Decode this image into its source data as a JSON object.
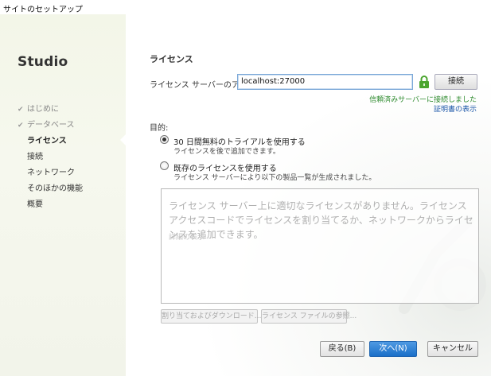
{
  "window": {
    "title": "サイトのセットアップ"
  },
  "sidebar": {
    "brand": "Studio",
    "items": [
      {
        "label": "はじめに",
        "state": "done"
      },
      {
        "label": "データベース",
        "state": "done"
      },
      {
        "label": "ライセンス",
        "state": "active"
      },
      {
        "label": "接続",
        "state": "pending"
      },
      {
        "label": "ネットワーク",
        "state": "pending"
      },
      {
        "label": "そのほかの機能",
        "state": "pending"
      },
      {
        "label": "概要",
        "state": "pending"
      }
    ],
    "check_icon": "✔"
  },
  "license": {
    "section_title": "ライセンス",
    "server_label": "ライセンス サーバーのアドレス:",
    "server_value": "localhost:27000",
    "lock_icon": "lock-icon",
    "connect_label": "接続",
    "trusted_text": "信頼済みサーバーに接続しました",
    "cert_link": "証明書の表示"
  },
  "purpose": {
    "label": "目的:",
    "option1": {
      "title": "30 日間無料のトライアルを使用する",
      "subtitle": "ライセンスを後で追加できます。",
      "selected": true
    },
    "option2": {
      "title": "既存のライセンスを使用する",
      "subtitle": "ライセンス サーバーにより以下の製品一覧が生成されました。",
      "selected": false
    }
  },
  "list": {
    "message": "ライセンス サーバー上に適切なライセンスがありません。ライセンス アクセスコードでライセンスを割り当てるか、ネットワークからライセンスを追加できます。",
    "detail_link": "詳細の表示"
  },
  "actions": {
    "assign_label": "割り当ておよびダウンロード...",
    "browse_label": "ライセンス ファイルの参照..."
  },
  "footer": {
    "back_label": "戻る(B)",
    "next_label": "次へ(N)",
    "cancel_label": "キャンセル"
  },
  "colors": {
    "accent": "#1a6fc8",
    "trusted": "#2d8a2d",
    "link": "#1a56a8",
    "lock": "#4aa52e"
  }
}
